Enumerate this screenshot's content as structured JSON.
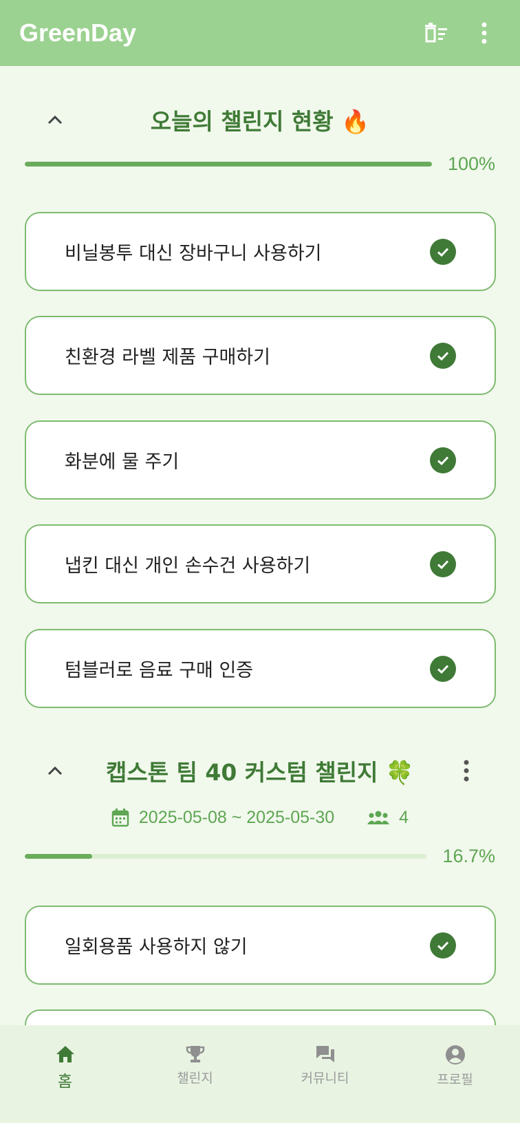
{
  "app": {
    "title": "GreenDay"
  },
  "colors": {
    "accent": "#3f7a36",
    "appbar": "#9cd291",
    "progress": "#6aab5c",
    "background": "#f1f8ec"
  },
  "appbar": {
    "icons": [
      "delete-sweep-icon",
      "more-vert-icon"
    ]
  },
  "daily": {
    "title": "오늘의 챌린지 현황 🔥",
    "progress": 100,
    "progress_label": "100%",
    "items": [
      {
        "label": "비닐봉투 대신 장바구니 사용하기",
        "done": true
      },
      {
        "label": "친환경 라벨 제품 구매하기",
        "done": true
      },
      {
        "label": "화분에 물 주기",
        "done": true
      },
      {
        "label": "냅킨 대신 개인 손수건 사용하기",
        "done": true
      },
      {
        "label": "텀블러로 음료 구매 인증",
        "done": true
      }
    ]
  },
  "custom": {
    "title": "캡스톤 팀 40 커스텀 챌린지 🍀",
    "period": "2025-05-08 ~ 2025-05-30",
    "members": "4",
    "progress": 16.7,
    "progress_label": "16.7%",
    "items": [
      {
        "label": "일회용품 사용하지 않기",
        "done": true
      }
    ]
  },
  "nav": {
    "items": [
      {
        "label": "홈",
        "icon": "home-icon",
        "active": true
      },
      {
        "label": "챌린지",
        "icon": "trophy-icon",
        "active": false
      },
      {
        "label": "커뮤니티",
        "icon": "forum-icon",
        "active": false
      },
      {
        "label": "프로필",
        "icon": "account-icon",
        "active": false
      }
    ]
  }
}
